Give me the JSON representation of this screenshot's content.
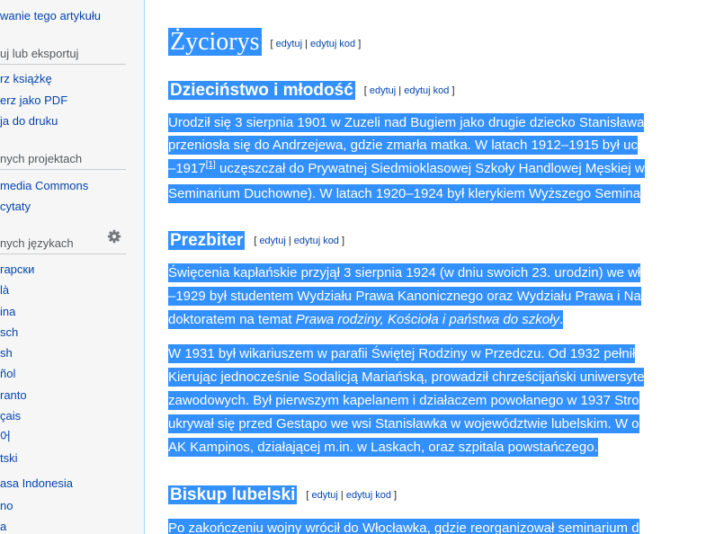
{
  "sidebar": {
    "top_link": "wanie tego artykułu",
    "print_heading": "uj lub eksportuj",
    "print_items": [
      "rz książkę",
      "erz jako PDF",
      "ja do druku"
    ],
    "projects_heading": "nych projektach",
    "project_items": [
      "media Commons",
      "cytaty"
    ],
    "languages_heading": "nych językach",
    "language_items": [
      "гарски",
      "là",
      "ina",
      "sch",
      "sh",
      "ñol",
      "ranto",
      "çais",
      "어",
      "tski",
      "asa Indonesia",
      "no",
      "a"
    ],
    "gear_icon": "gear-icon"
  },
  "content": {
    "section_heading": "Życiorys",
    "edit_links": {
      "open": "[ ",
      "edit": "edytuj",
      "sep": " | ",
      "edit_source": "edytuj kod",
      "close": " ]"
    },
    "subsections": [
      {
        "heading": "Dzieciństwo i młodość"
      },
      {
        "heading": "Prezbiter"
      },
      {
        "heading": "Biskup lubelski"
      }
    ],
    "para1": [
      "Urodził się 3 sierpnia 1901 w Zuzeli nad Bugiem jako drugie dziecko Stanisława",
      "przeniosła się do Andrzejewa, gdzie zmarła matka. W latach 1912–1915 był uc",
      {
        "before": "–1917",
        "ref": "[1]",
        "after": " uczęszczał do Prywatnej Siedmioklasowej Szkoły Handlowej Męskiej w"
      },
      "Seminarium Duchowne). W latach 1920–1924 był klerykiem Wyższego Semina"
    ],
    "para2": [
      "Święcenia kapłańskie przyjął 3 sierpnia 1924 (w dniu swoich 23. urodzin) we wł",
      "–1929 był studentem Wydziału Prawa Kanonicznego oraz Wydziału Prawa i Na",
      {
        "before": "doktoratem na temat ",
        "italic": "Prawa rodziny, Kościoła i państwa do szkoły",
        "after": "."
      }
    ],
    "para3": [
      "W 1931 był wikariuszem w parafii Świętej Rodziny w Przedczu. Od 1932 pełnił",
      "Kierując jednocześnie Sodalicją Mariańską, prowadził chrześcijański uniwersyte",
      "zawodowych. Był pierwszym kapelanem i działaczem powołanego w 1937 Stro",
      "ukrywał się przed Gestapo we wsi Stanisławka w województwie lubelskim. W o",
      "AK Kampinos, działającej m.in. w Laskach, oraz szpitala powstańczego."
    ],
    "para4": [
      "Po zakończeniu wojny wrócił do Włocławka, gdzie reorganizował seminarium d"
    ],
    "selection_color": "#3390ff",
    "link_color": "#0645ad"
  }
}
